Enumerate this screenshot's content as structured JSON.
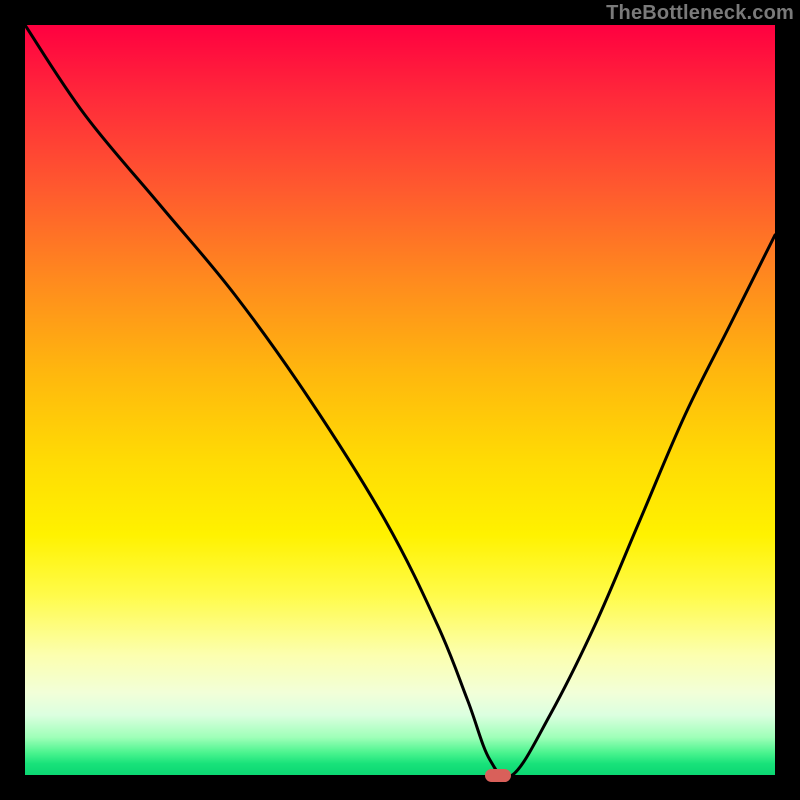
{
  "watermark": "TheBottleneck.com",
  "chart_data": {
    "type": "line",
    "title": "",
    "xlabel": "",
    "ylabel": "",
    "xlim": [
      0,
      100
    ],
    "ylim": [
      0,
      100
    ],
    "grid": false,
    "legend": false,
    "background_gradient": {
      "top_color": "#ff0040",
      "mid_color": "#fff200",
      "bottom_color": "#0bd772"
    },
    "series": [
      {
        "name": "bottleneck-curve",
        "color": "#000000",
        "x": [
          0,
          8,
          18,
          28,
          38,
          48,
          55,
          59,
          62,
          65,
          70,
          76,
          82,
          88,
          94,
          100
        ],
        "values": [
          100,
          88,
          76,
          64,
          50,
          34,
          20,
          10,
          2,
          0,
          8,
          20,
          34,
          48,
          60,
          72
        ]
      }
    ],
    "marker": {
      "name": "optimal-point",
      "x": 63,
      "y": 0,
      "color": "#d9605a"
    }
  }
}
